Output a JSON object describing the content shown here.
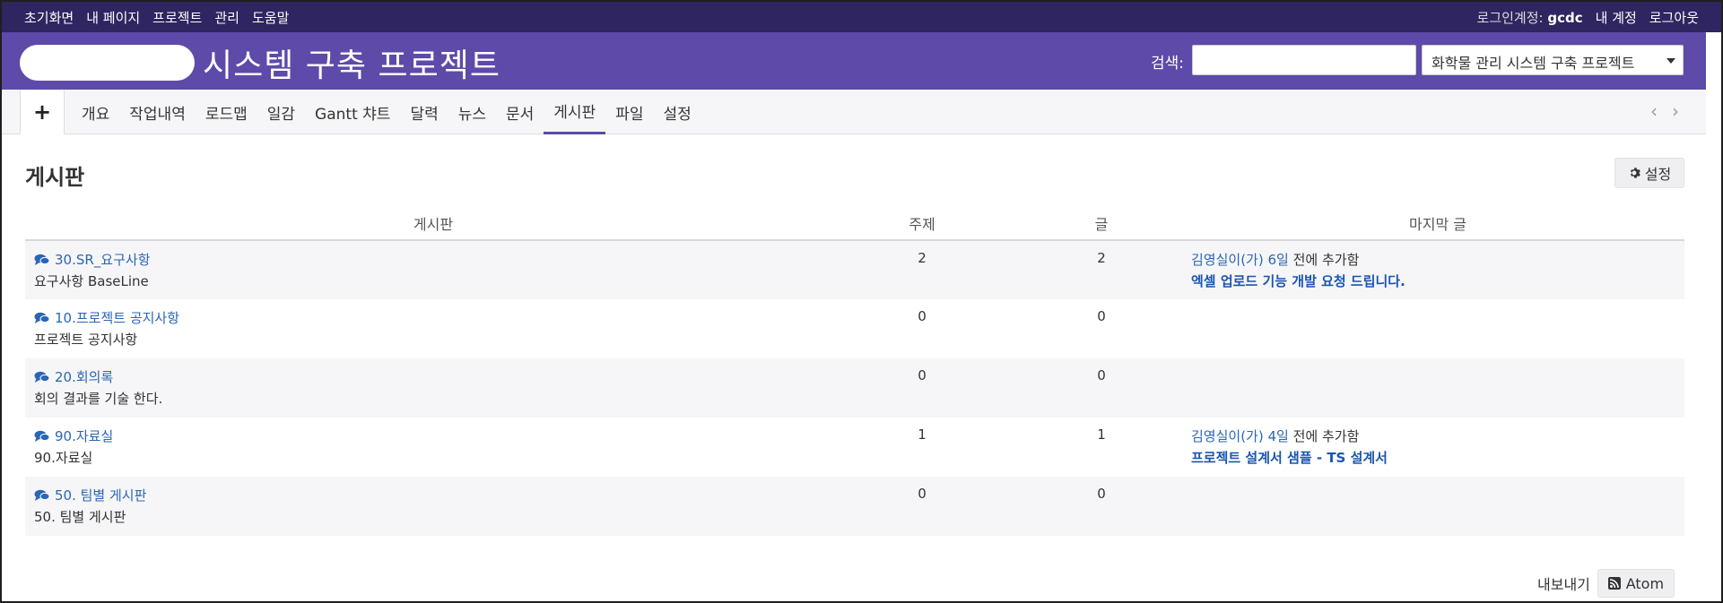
{
  "top_menu": {
    "items": [
      "초기화면",
      "내 페이지",
      "프로젝트",
      "관리",
      "도움말"
    ],
    "login_label": "로그인계정:",
    "login_user": "gcdc",
    "my_account": "내 계정",
    "logout": "로그아웃"
  },
  "header": {
    "project_title": "시스템 구축 프로젝트",
    "search_label": "검색:",
    "search_value": "",
    "project_jump": "화학물 관리 시스템 구축 프로젝트"
  },
  "tabs": [
    "개요",
    "작업내역",
    "로드맵",
    "일감",
    "Gantt 챠트",
    "달력",
    "뉴스",
    "문서",
    "게시판",
    "파일",
    "설정"
  ],
  "selected_tab": "게시판",
  "new_object_label": "+",
  "page": {
    "title": "게시판",
    "settings_label": "설정",
    "columns": {
      "board": "게시판",
      "topics": "주제",
      "posts": "글",
      "last": "마지막 글"
    },
    "boards": [
      {
        "name": "30.SR_요구사항",
        "desc": "요구사항 BaseLine",
        "topics": "2",
        "posts": "2",
        "last_author": "김영실이(가)",
        "last_time": "6일",
        "last_suffix": "전에 추가함",
        "last_title": "엑셀 업로드 기능 개발 요청 드립니다."
      },
      {
        "name": "10.프로젝트 공지사항",
        "desc": "프로젝트 공지사항",
        "topics": "0",
        "posts": "0",
        "last_author": "",
        "last_time": "",
        "last_suffix": "",
        "last_title": ""
      },
      {
        "name": "20.회의록",
        "desc": "회의 결과를 기술 한다.",
        "topics": "0",
        "posts": "0",
        "last_author": "",
        "last_time": "",
        "last_suffix": "",
        "last_title": ""
      },
      {
        "name": "90.자료실",
        "desc": "90.자료실",
        "topics": "1",
        "posts": "1",
        "last_author": "김영실이(가)",
        "last_time": "4일",
        "last_suffix": "전에 추가함",
        "last_title": "프로젝트 설계서 샘플 - TS 설계서"
      },
      {
        "name": "50. 팀별 게시판",
        "desc": "50. 팀별 게시판",
        "topics": "0",
        "posts": "0",
        "last_author": "",
        "last_time": "",
        "last_suffix": "",
        "last_title": ""
      }
    ],
    "export_label": "내보내기",
    "atom_label": "Atom"
  },
  "colors": {
    "top_bar": "#2f2560",
    "header": "#5e4aa8",
    "link": "#2a66b5",
    "tab_selected_underline": "#5e4aa8"
  }
}
